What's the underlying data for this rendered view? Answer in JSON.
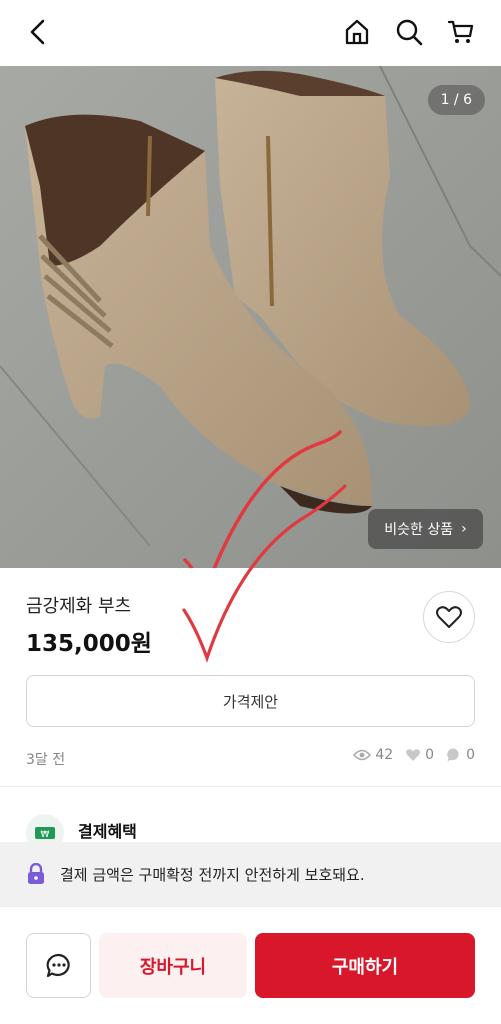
{
  "header": {
    "back_icon": "chevron-left-icon",
    "home_icon": "home-icon",
    "search_icon": "search-icon",
    "cart_icon": "cart-icon"
  },
  "gallery": {
    "counter": "1 / 6",
    "similar_label": "비슷한 상품",
    "similar_arrow": "›",
    "colors": {
      "floor": "#9b9d99",
      "boot": "#b9a58a",
      "annotation": "#e0393f"
    }
  },
  "product": {
    "title": "금강제화 부츠",
    "price": "135,000원",
    "like_icon": "heart-outline-icon"
  },
  "offer": {
    "label": "가격제안"
  },
  "meta": {
    "posted": "3달 전",
    "views": "42",
    "likes": "0",
    "chats": "0"
  },
  "benefit": {
    "title": "결제혜택",
    "icon": "won-coupon-icon"
  },
  "safety": {
    "text": "결제 금액은 구매확정 전까지 안전하게 보호돼요.",
    "icon": "lock-icon"
  },
  "actions": {
    "chat_icon": "chat-bubble-icon",
    "cart_label": "장바구니",
    "buy_label": "구매하기",
    "brand_color": "#d9172a"
  }
}
